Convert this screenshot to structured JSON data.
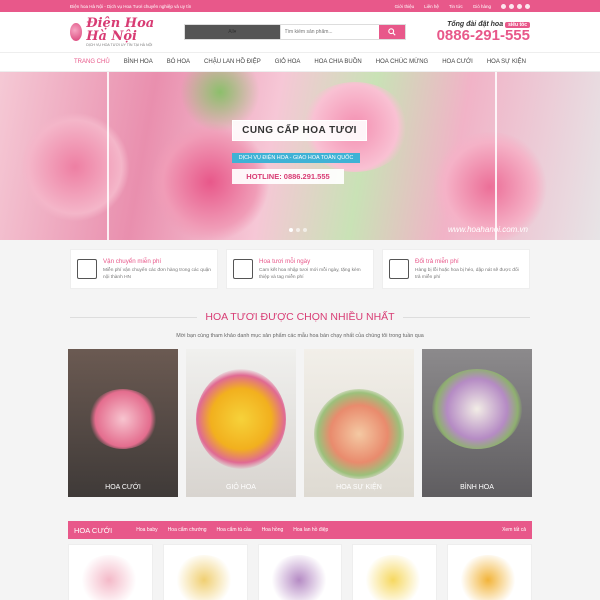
{
  "topbar": {
    "left_text": "Điện hoa Hà Nội - Dịch vụ Hoa Tươi chuyên nghiệp và uy tín",
    "links": [
      "Giới thiệu",
      "Liên hệ",
      "Tin tức",
      "Giỏ hàng"
    ]
  },
  "header": {
    "logo_name": "Điện Hoa Hà Nội",
    "logo_tagline": "DỊCH VỤ HOA TƯƠI UY TÍN TẠI HÀ NỘI",
    "search": {
      "category": "All",
      "placeholder": "Tìm kiếm sản phẩm..."
    },
    "order_label": "Tổng đài đặt hoa",
    "order_badge": "siêu tốc",
    "hotline": "0886-291-555"
  },
  "nav": [
    "TRANG CHỦ",
    "BÌNH HOA",
    "BÓ HOA",
    "CHẬU LAN HỒ ĐIỆP",
    "GIỎ HOA",
    "HOA CHIA BUỒN",
    "HOA CHÚC MỪNG",
    "HOA CƯỚI",
    "HOA SỰ KIỆN"
  ],
  "hero": {
    "title": "CUNG CẤP HOA TƯƠI",
    "subtitle": "DỊCH VỤ ĐIỆN HOA - GIAO HOA TOÀN QUỐC",
    "hotline": "HOTLINE: 0886.291.555",
    "website": "www.hoahanoi.com.vn"
  },
  "features": [
    {
      "title": "Vận chuyển miễn phí",
      "desc": "Miễn phí vận chuyển các đơn hàng trong các quận nội thành HN",
      "icon": "building-icon"
    },
    {
      "title": "Hoa tươi mỗi ngày",
      "desc": "Cam kết hoa nhập tươi mới mỗi ngày, tặng kèm thiệp và tag miễn phí",
      "icon": "truck-icon"
    },
    {
      "title": "Đổi trả miễn phí",
      "desc": "Hàng bị lỗi hoặc hoa bị héo, dập nát sẽ được đổi trả miễn phí",
      "icon": "return-icon"
    }
  ],
  "section": {
    "title": "HOA TƯƠI ĐƯỢC CHỌN NHIỀU NHẤT",
    "desc": "Mời bạn cùng tham khảo danh mục sản phẩm các mẫu hoa bán chạy nhất của chúng tôi trong tuần qua"
  },
  "categories": [
    "HOA CƯỚI",
    "GIỎ HOA",
    "HOA SỰ KIỆN",
    "BÌNH HOA"
  ],
  "tabs": {
    "main": "HOA CƯỚI",
    "items": [
      "Hoa baby",
      "Hoa cẩm chướng",
      "Hoa cẩm tú cầu",
      "Hoa hồng",
      "Hoa lan hồ điệp"
    ],
    "view_all": "Xem tất cả"
  },
  "colors": {
    "accent": "#e8588a",
    "accent_dark": "#d83c74",
    "info": "#3fb2d5"
  }
}
